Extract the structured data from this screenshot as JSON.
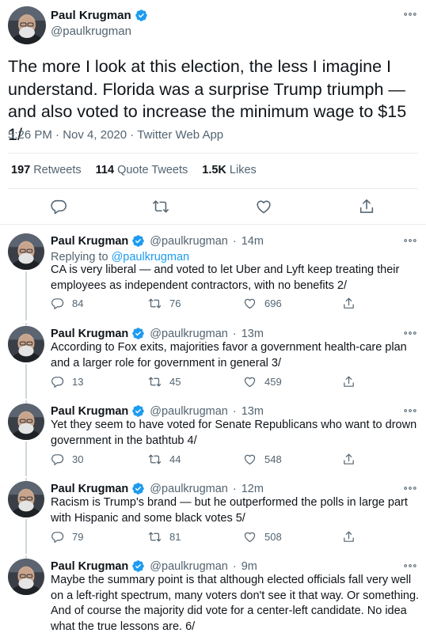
{
  "main_tweet": {
    "author_name": "Paul Krugman",
    "author_handle": "@paulkrugman",
    "text": "The more I look at this election, the less I imagine I understand. Florida was a surprise Trump triumph — and also voted to increase the minimum wage to $15 1/",
    "time": "5:26 PM",
    "date": "Nov 4, 2020",
    "source": "Twitter Web App",
    "retweets_count": "197",
    "retweets_label": "Retweets",
    "quotes_count": "114",
    "quotes_label": "Quote Tweets",
    "likes_count": "1.5K",
    "likes_label": "Likes"
  },
  "replies": [
    {
      "name": "Paul Krugman",
      "handle": "@paulkrugman",
      "time": "14m",
      "replying_prefix": "Replying to",
      "replying_to": "@paulkrugman",
      "text": "CA is very liberal — and voted to let Uber and Lyft keep treating their employees as independent contractors, with no benefits 2/",
      "replies": "84",
      "retweets": "76",
      "likes": "696"
    },
    {
      "name": "Paul Krugman",
      "handle": "@paulkrugman",
      "time": "13m",
      "text": "According to Fox exits, majorities favor a government health-care plan and a larger role for government in general 3/",
      "replies": "13",
      "retweets": "45",
      "likes": "459"
    },
    {
      "name": "Paul Krugman",
      "handle": "@paulkrugman",
      "time": "13m",
      "text": "Yet they seem to have voted for Senate Republicans who want to drown government in the bathtub 4/",
      "replies": "30",
      "retweets": "44",
      "likes": "548"
    },
    {
      "name": "Paul Krugman",
      "handle": "@paulkrugman",
      "time": "12m",
      "text": "Racism is Trump's brand — but he outperformed the polls in large part with Hispanic and some black votes 5/",
      "replies": "79",
      "retweets": "81",
      "likes": "508"
    },
    {
      "name": "Paul Krugman",
      "handle": "@paulkrugman",
      "time": "9m",
      "text": "Maybe the summary point is that although elected officials fall very well on a left-right spectrum, many voters don't see it that way. Or something. And of course the majority did vote for a center-left candidate. No idea what the true lessons are. 6/"
    }
  ],
  "colors": {
    "text": "#0f1419",
    "muted": "#536471",
    "accent": "#1d9bf0",
    "border": "#e6ecf0"
  },
  "icons": [
    "verified-badge-icon",
    "more-options-icon",
    "reply-icon",
    "retweet-icon",
    "like-icon",
    "share-icon"
  ]
}
